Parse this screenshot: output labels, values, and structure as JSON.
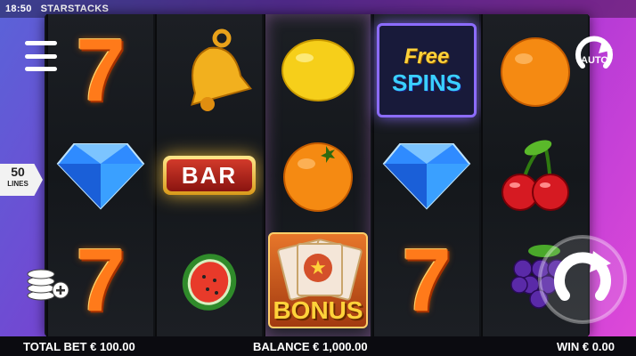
{
  "status_bar": {
    "time": "18:50",
    "app_title": "STARSTACKS"
  },
  "controls": {
    "menu_icon": "hamburger-menu-icon",
    "auto_label": "AUTO",
    "lines_count": "50",
    "lines_label": "LINES",
    "bet_icon": "coin-stack-plus-icon",
    "spin_icon": "spin-arrow-icon"
  },
  "reels": [
    [
      "seven",
      "bell",
      "seven"
    ],
    [
      "bell",
      "bar",
      "watermelon"
    ],
    [
      "lemon",
      "orange",
      "bonus"
    ],
    [
      "free-spins",
      "diamond",
      "seven"
    ],
    [
      "orange",
      "cherries",
      "grapes"
    ]
  ],
  "symbol_text": {
    "bar": "BAR",
    "free_line1": "Free",
    "free_line2": "SPINS",
    "bonus": "BONUS"
  },
  "footer": {
    "total_bet": "TOTAL BET € 100.00",
    "balance": "BALANCE € 1,000.00",
    "win": "WIN € 0.00"
  },
  "colors": {
    "accent_purple": "#b23ad6",
    "seven_orange": "#ff7a1a",
    "gold": "#ffd23a"
  }
}
